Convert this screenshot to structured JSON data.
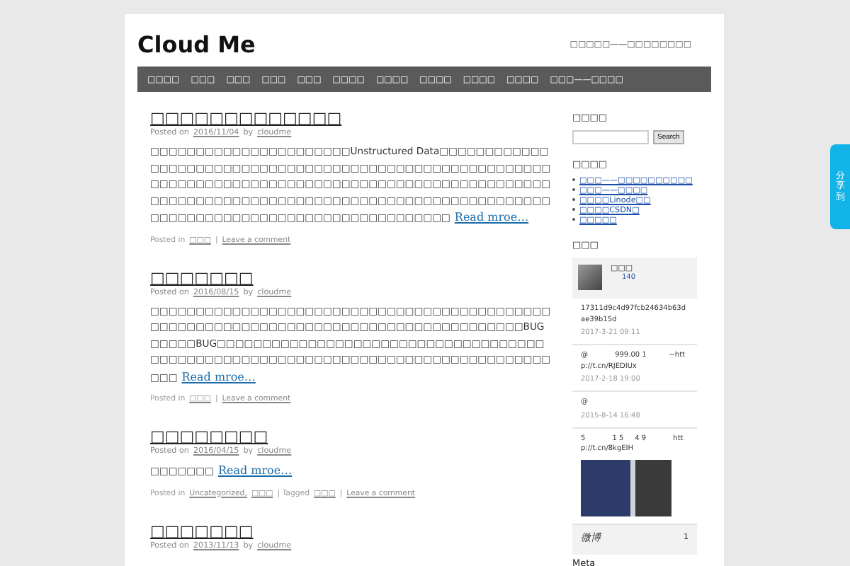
{
  "site": {
    "title": "Cloud Me",
    "tagline": "□□□□□——□□□□□□□□"
  },
  "nav": [
    "□□□□",
    "□□□",
    "□□□",
    "□□□",
    "□□□",
    "□□□□",
    "□□□□",
    "□□□□",
    "□□□□",
    "□□□□",
    "□□□——□□□□"
  ],
  "posts": [
    {
      "title": "□□□□□□□□□□□□□",
      "meta": [
        {
          "kind": "text",
          "text": "Posted on"
        },
        {
          "kind": "link",
          "text": "2016/11/04"
        },
        {
          "kind": "text",
          "text": "by"
        },
        {
          "kind": "link",
          "text": "cloudme"
        }
      ],
      "body": "□□□□□□□□□□□□□□□□□□□□□□Unstructured Data□□□□□□□□□□□□□□□□□□□□□□□□□□□□□□□□□□□□□□□□□□□□□□□□□□□□□□□□□□□□□□□□□□□□□□□□□□□□□□□□□□□□□□□□□□□□□□□□□□□□□□□□□□□□□□□□□□□□□□□□□□□□□□□□□□□□□□□□□□□□□□□□□□□□□□□□□□□□□□□□□□□□□□□□□□□□□□□□□",
      "more": "Read mroe…",
      "footer": [
        {
          "kind": "text",
          "text": "Posted in"
        },
        {
          "kind": "link",
          "text": "□□□"
        },
        {
          "kind": "text",
          "text": "|"
        },
        {
          "kind": "link",
          "text": "Leave a comment"
        }
      ]
    },
    {
      "title": "□□□□□□□",
      "meta": [
        {
          "kind": "text",
          "text": "Posted on"
        },
        {
          "kind": "link",
          "text": "2016/08/15"
        },
        {
          "kind": "text",
          "text": "by"
        },
        {
          "kind": "link",
          "text": "cloudme"
        }
      ],
      "body": "□□□□□□□□□□□□□□□□□□□□□□□□□□□□□□□□□□□□□□□□□□□□□□□□□□□□□□□□□□□□□□□□□□□□□□□□□□□□□□□□□□□□□BUG□□□□□BUG□□□□□□□□□□□□□□□□□□□□□□□□□□□□□□□□□□□□□□□□□□□□□□□□□□□□□□□□□□□□□□□□□□□□□□□□□□□□□□□□□□□",
      "more": "Read mroe…",
      "footer": [
        {
          "kind": "text",
          "text": "Posted in"
        },
        {
          "kind": "link",
          "text": "□□□"
        },
        {
          "kind": "text",
          "text": "|"
        },
        {
          "kind": "link",
          "text": "Leave a comment"
        }
      ]
    },
    {
      "title": "□□□□□□□□",
      "meta": [
        {
          "kind": "text",
          "text": "Posted on"
        },
        {
          "kind": "link",
          "text": "2016/04/15"
        },
        {
          "kind": "text",
          "text": "by"
        },
        {
          "kind": "link",
          "text": "cloudme"
        }
      ],
      "body": "□□□□□□□",
      "more": "Read mroe…",
      "footer": [
        {
          "kind": "text",
          "text": "Posted in"
        },
        {
          "kind": "link",
          "text": "Uncategorized,"
        },
        {
          "kind": "link",
          "text": "□□□"
        },
        {
          "kind": "text",
          "text": "| Tagged"
        },
        {
          "kind": "link",
          "text": "□□□"
        },
        {
          "kind": "text",
          "text": "|"
        },
        {
          "kind": "link",
          "text": "Leave a comment"
        }
      ]
    },
    {
      "title": "□□□□□□□",
      "meta": [
        {
          "kind": "text",
          "text": "Posted on"
        },
        {
          "kind": "link",
          "text": "2013/11/13"
        },
        {
          "kind": "text",
          "text": "by"
        },
        {
          "kind": "link",
          "text": "cloudme"
        }
      ]
    }
  ],
  "sidebar": {
    "search_heading": "□□□□",
    "search_button": "Search",
    "links_heading": "□□□□",
    "links": [
      "□□□——□□□□□□□□□□",
      "□□□——□□□□",
      "□□□□Linode□□",
      "□□□□CSDN□",
      "□□□□□"
    ],
    "weibo_heading": "□□□",
    "weibo": {
      "name": "□□□",
      "count": "140",
      "feed": [
        {
          "text": "17311d9c4d97fcb24634b63dae39b15d",
          "time": "2017-3-21 09:11",
          "photo": false
        },
        {
          "text": "@            999.00 1          ~http://t.cn/RJEDIUx",
          "time": "2017-2-18 19:00",
          "photo": false
        },
        {
          "text": "@",
          "time": "2015-8-14 16:48",
          "photo": false
        },
        {
          "text": "5            1 5     4 9            http://t.cn/8kgEIH",
          "photo": true
        }
      ],
      "brand": "微博",
      "brand_count": "1"
    },
    "meta_heading": "Meta"
  },
  "share": "分享到"
}
